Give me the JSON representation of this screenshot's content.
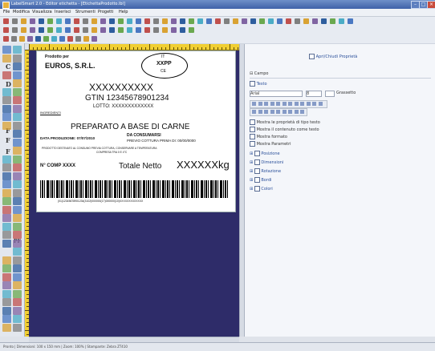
{
  "window": {
    "title": "LabelSmart 2.0 - Editor etichetta - [EtichettaProdotto.lbl]"
  },
  "menu": [
    "File",
    "Modifica",
    "Visualizza",
    "Inserisci",
    "Strumenti",
    "Progetti",
    "Help"
  ],
  "label": {
    "producer_caption": "Prodotto per",
    "producer_name": "EUROS, S.R.L.",
    "stamp_top": "IT",
    "stamp_mid": "XXPP",
    "stamp_bot": "CE",
    "product_code": "XXXXXXXXXX",
    "gtin": "GTIN 12345678901234",
    "lotto": "LOTTO: XXXXXXXXXXXXX",
    "small_note": "INGREDIENTI",
    "product_title": "PREPARATO A BASE DI CARNE",
    "prod_date_label": "DATA PRODUZIONE: 07/07/2010",
    "consume_label": "DA CONSUMARSI",
    "consume_detail": "PREVIO COTTURA PRIMA DI: 00/00/0000",
    "warning_line1": "PRODOTTO DESTINATO AL CONSUMO PREVIA COTTURA, CONSERVARE A TEMPERATURA",
    "warning_line2": "COMPRESA TRA 0 E 4°C",
    "colli_label": "N° COMP  XXXX",
    "net_label": "Totale Netto",
    "net_value": "XXXXXXkg",
    "barcode_text": "(01)12345678901234(3102)000000(17)000000(10)XXXXXXXXXXXXX"
  },
  "panel": {
    "top_link": "Apri/Chiudi Proprietà",
    "section_title": "Campo",
    "field_label": "Testo",
    "font_name": "Arial",
    "font_size": "8",
    "style_label": "Grassetto",
    "options": [
      "Mostra le proprietà di tipo testo",
      "Mostra il contenuto come testo",
      "Mostra formato",
      "Mostra Parametri"
    ],
    "tree": [
      "Posizione",
      "Dimensioni",
      "Rotazione",
      "Bordi",
      "Colori"
    ]
  },
  "status": {
    "text": "Pronto  |  Dimensioni: 100 x 150 mm  |  Zoom: 100%  |  Stampante: Zebra ZT410"
  },
  "colors": {
    "accent": "#3f62a8",
    "ruler": "#f1cf33",
    "canvas": "#2e2c69"
  }
}
